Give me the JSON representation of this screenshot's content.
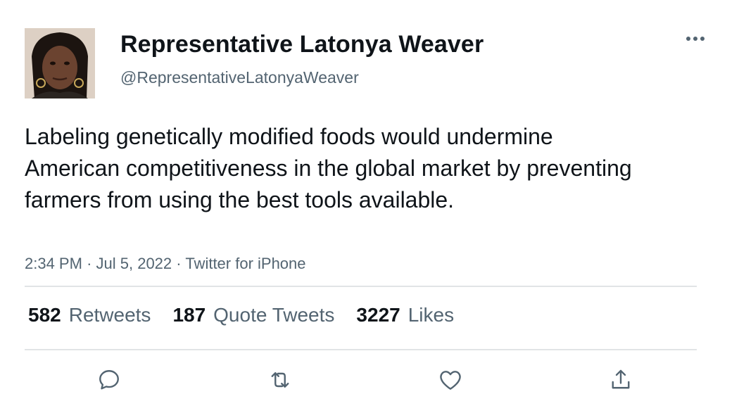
{
  "author": {
    "display_name": "Representative Latonya Weaver",
    "handle": "@RepresentativeLatonyaWeaver",
    "avatar_icon": "profile-photo"
  },
  "tweet": {
    "text": "Labeling genetically modified foods would undermine American competitiveness in the global market by preventing farmers from using the best tools available.",
    "time": "2:34 PM",
    "separator": "·",
    "date": "Jul 5, 2022",
    "source": "Twitter for iPhone"
  },
  "stats": {
    "retweets_count": "582",
    "retweets_label": "Retweets",
    "quotes_count": "187",
    "quotes_label": "Quote Tweets",
    "likes_count": "3227",
    "likes_label": "Likes"
  },
  "actions": [
    "reply-icon",
    "retweet-icon",
    "like-icon",
    "share-icon"
  ],
  "more_icon": "more-icon",
  "colors": {
    "text_primary": "#0f1419",
    "text_secondary": "#536471",
    "divider": "#e1e4e6",
    "icon": "#536471"
  }
}
